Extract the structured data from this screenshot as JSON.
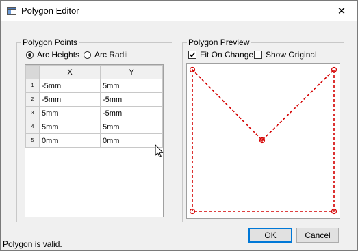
{
  "window": {
    "title": "Polygon Editor",
    "close_glyph": "✕"
  },
  "points_group": {
    "title": "Polygon Points",
    "radio_arc_heights": "Arc Heights",
    "radio_arc_radii": "Arc Radii",
    "selected_mode": "Arc Heights",
    "columns": [
      "X",
      "Y"
    ],
    "rows": [
      {
        "index": "1",
        "x": "-5mm",
        "y": "5mm"
      },
      {
        "index": "2",
        "x": "-5mm",
        "y": "-5mm"
      },
      {
        "index": "3",
        "x": "5mm",
        "y": "-5mm"
      },
      {
        "index": "4",
        "x": "5mm",
        "y": "5mm"
      },
      {
        "index": "5",
        "x": "0mm",
        "y": "0mm"
      }
    ]
  },
  "preview_group": {
    "title": "Polygon Preview",
    "fit_on_change_label": "Fit On Change",
    "fit_on_change_checked": true,
    "show_original_label": "Show Original",
    "show_original_checked": false,
    "accent_color": "#d40000"
  },
  "buttons": {
    "ok": "OK",
    "cancel": "Cancel"
  },
  "status": "Polygon is valid."
}
